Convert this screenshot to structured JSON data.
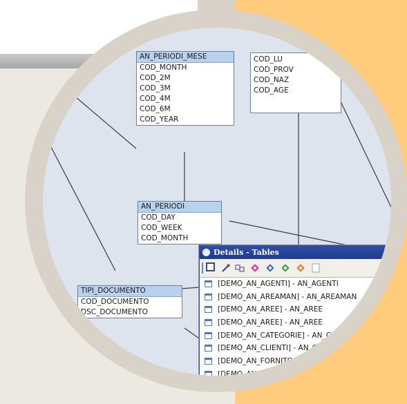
{
  "tables": {
    "periodi_mese": {
      "name": "AN_PERIODI_MESE",
      "header_text": "AN_PERIODI_MESE",
      "fields": [
        "COD_MONTH",
        "COD_2M",
        "COD_3M",
        "COD_4M",
        "COD_6M",
        "COD_YEAR"
      ]
    },
    "geo": {
      "header_text": "COD_LU",
      "fields": [
        "COD_PROV",
        "COD_NAZ",
        "COD_AGE"
      ]
    },
    "periodi": {
      "header_text": "AN_PERIODI",
      "fields": [
        "COD_DAY",
        "COD_WEEK",
        "COD_MONTH"
      ]
    },
    "tipi_documento": {
      "header_text": "TIPI_DOCUMENTO",
      "fields": [
        "COD_DOCUMENTO",
        "DSC_DOCUMENTO"
      ]
    }
  },
  "details_dialog": {
    "title": "Details - Tables",
    "toolbar": [
      {
        "icon": "window-icon"
      },
      {
        "icon": "pencil-icon"
      },
      {
        "icon": "link-icon"
      },
      {
        "icon": "diamond-icon",
        "color": "#e0218a"
      },
      {
        "icon": "diamond-icon",
        "color": "#2a66d8"
      },
      {
        "icon": "diamond-icon",
        "color": "#2e9e3e"
      },
      {
        "icon": "diamond-icon",
        "color": "#e07a20"
      },
      {
        "icon": "page-icon"
      }
    ],
    "rows": [
      "[DEMO_AN_AGENTI] - AN_AGENTI",
      "[DEMO_AN_AREAMAN] - AN_AREAMAN",
      "[DEMO_AN_AREE] - AN_AREE",
      "[DEMO_AN_AREE] - AN_AREE",
      "[DEMO_AN_CATEGORIE] - AN_CATEGORIE",
      "[DEMO_AN_CLIENTI] - AN_CLIENTI",
      "[DEMO_AN_FORNITORI] - AN_FORNITORI",
      "[DEMO_AN_..."
    ]
  },
  "colors": {
    "lens_ring": "#d8d2c9",
    "orange_panel": "#ffcb7d",
    "canvas_bg": "#dde4ee",
    "table_header": "#b8d2ee",
    "dialog_title": "#1d3a8f"
  }
}
